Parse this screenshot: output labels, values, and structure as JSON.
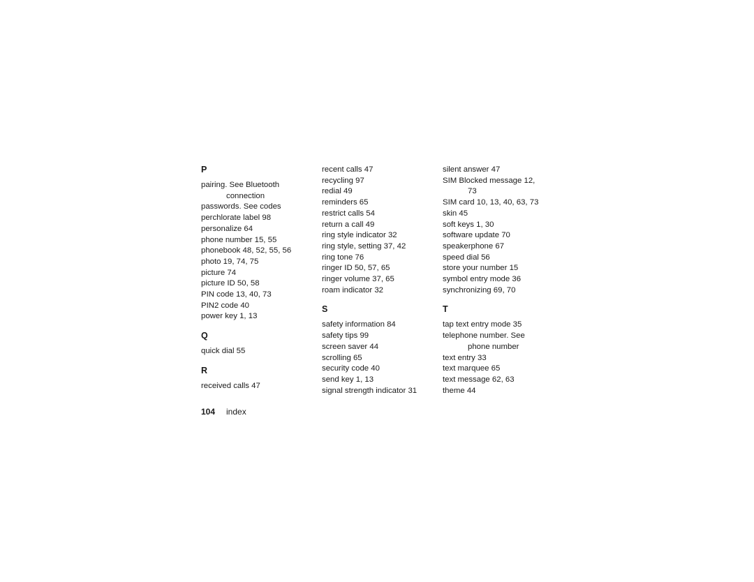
{
  "page": {
    "number": "104",
    "section": "index"
  },
  "columns": [
    {
      "groups": [
        {
          "letter": "P",
          "entries": [
            {
              "text": "pairing. See Bluetooth",
              "cont": "connection"
            },
            {
              "text": "passwords. See codes"
            },
            {
              "text": "perchlorate label  98"
            },
            {
              "text": "personalize  64"
            },
            {
              "text": "phone number  15, 55"
            },
            {
              "text": "phonebook  48, 52, 55, 56"
            },
            {
              "text": "photo  19, 74, 75"
            },
            {
              "text": "picture  74"
            },
            {
              "text": "picture ID  50, 58"
            },
            {
              "text": "PIN code  13, 40, 73"
            },
            {
              "text": "PIN2 code  40"
            },
            {
              "text": "power key  1, 13"
            }
          ]
        },
        {
          "letter": "Q",
          "entries": [
            {
              "text": "quick dial  55"
            }
          ]
        },
        {
          "letter": "R",
          "entries": [
            {
              "text": "received calls  47"
            }
          ]
        }
      ]
    },
    {
      "groups": [
        {
          "letter": "",
          "entries": [
            {
              "text": "recent calls  47"
            },
            {
              "text": "recycling  97"
            },
            {
              "text": "redial  49"
            },
            {
              "text": "reminders  65"
            },
            {
              "text": "restrict calls  54"
            },
            {
              "text": "return a call  49"
            },
            {
              "text": "ring style indicator  32"
            },
            {
              "text": "ring style, setting  37, 42"
            },
            {
              "text": "ring tone  76"
            },
            {
              "text": "ringer ID  50, 57, 65"
            },
            {
              "text": "ringer volume  37, 65"
            },
            {
              "text": "roam indicator  32"
            }
          ]
        },
        {
          "letter": "S",
          "entries": [
            {
              "text": "safety information  84"
            },
            {
              "text": "safety tips  99"
            },
            {
              "text": "screen saver  44"
            },
            {
              "text": "scrolling  65"
            },
            {
              "text": "security code  40"
            },
            {
              "text": "send key  1, 13"
            },
            {
              "text": "signal strength indicator  31"
            }
          ]
        }
      ]
    },
    {
      "groups": [
        {
          "letter": "",
          "entries": [
            {
              "text": "silent answer  47"
            },
            {
              "text": "SIM Blocked message  12,",
              "cont": "73"
            },
            {
              "text": "SIM card  10, 13, 40, 63, 73"
            },
            {
              "text": "skin  45"
            },
            {
              "text": "soft keys  1, 30"
            },
            {
              "text": "software update  70"
            },
            {
              "text": "speakerphone  67"
            },
            {
              "text": "speed dial  56"
            },
            {
              "text": "store your number  15"
            },
            {
              "text": "symbol entry mode  36"
            },
            {
              "text": "synchronizing  69, 70"
            }
          ]
        },
        {
          "letter": "T",
          "entries": [
            {
              "text": "tap text entry mode  35"
            },
            {
              "text": "telephone number. See",
              "cont": "phone number"
            },
            {
              "text": "text entry  33"
            },
            {
              "text": "text marquee  65"
            },
            {
              "text": "text message  62, 63"
            },
            {
              "text": "theme  44"
            }
          ]
        }
      ]
    }
  ]
}
